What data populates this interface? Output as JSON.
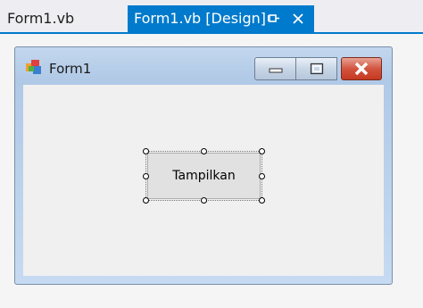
{
  "tabs": [
    {
      "label": "Form1.vb",
      "active": false
    },
    {
      "label": "Form1.vb [Design]",
      "active": true
    }
  ],
  "tab_icons": {
    "pin": "pin-icon",
    "close": "close-icon"
  },
  "form": {
    "title": "Form1",
    "icon": "form-app-icon",
    "caption_buttons": [
      "minimize",
      "maximize",
      "close"
    ]
  },
  "button": {
    "label": "Tampilkan"
  },
  "colors": {
    "accent": "#007acc",
    "close_button": "#c5391f",
    "client_background": "#f0f0f0"
  }
}
